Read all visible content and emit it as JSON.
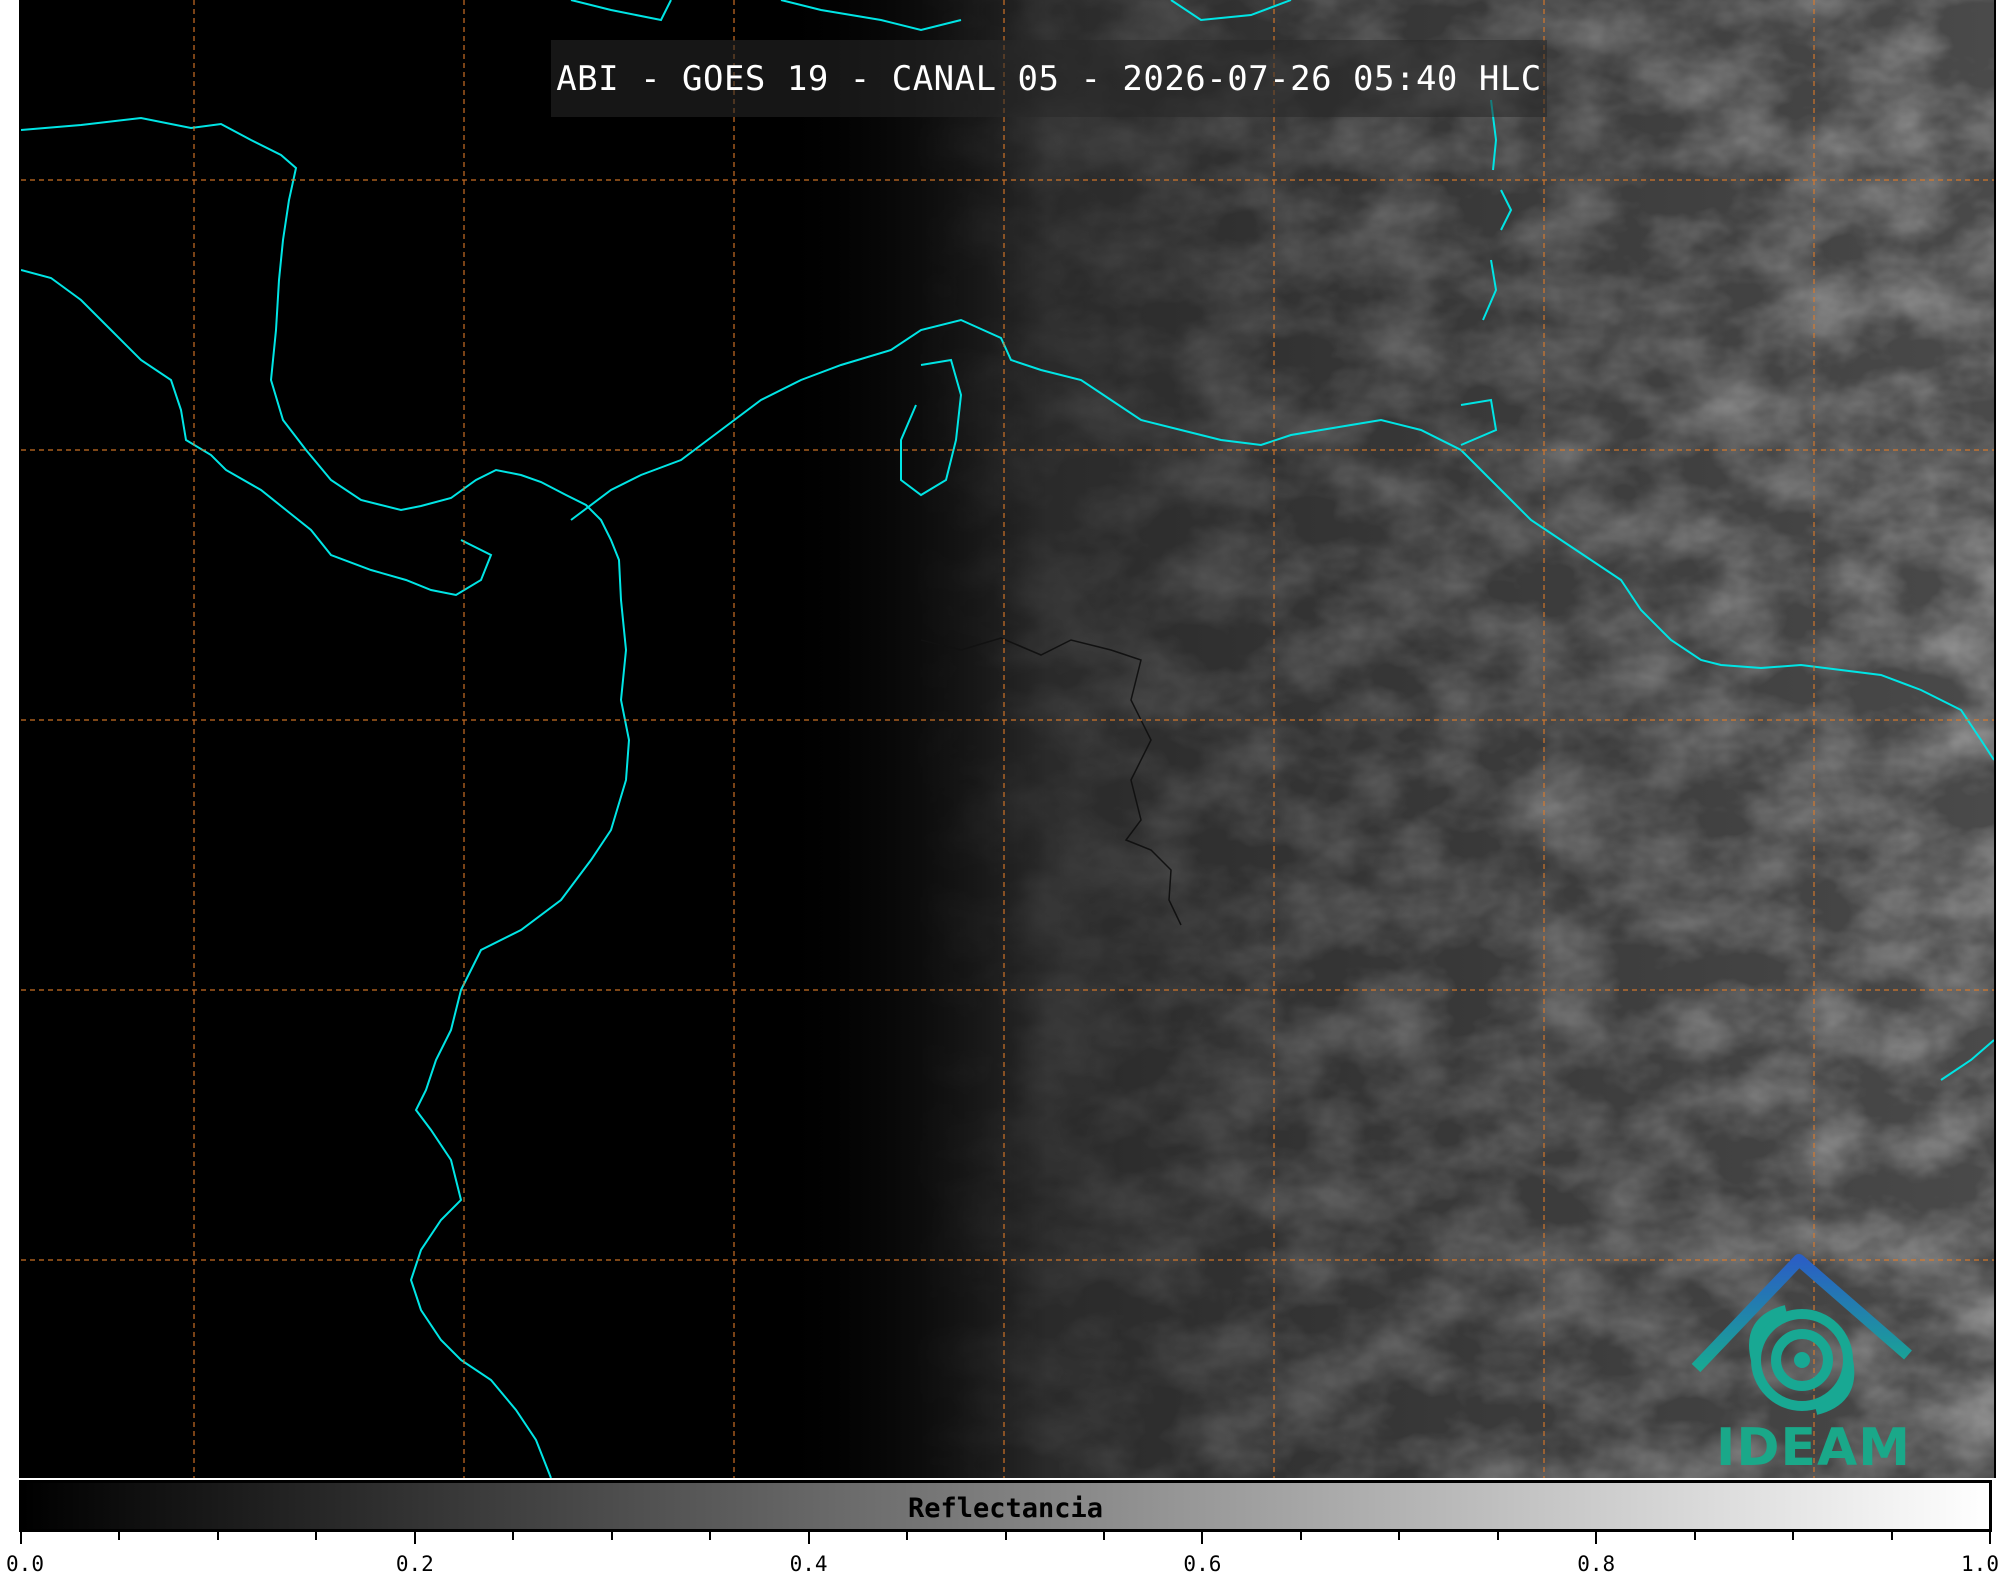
{
  "title": "ABI - GOES 19 - CANAL 05 - 2026-07-26 05:40 HLC",
  "colorbar": {
    "label": "Reflectancia",
    "range": [
      0.0,
      1.0
    ],
    "ticks": [
      "0.0",
      "0.2",
      "0.4",
      "0.6",
      "0.8",
      "1.0"
    ],
    "colormap": "grayscale"
  },
  "logo": {
    "text": "IDEAM"
  },
  "colors": {
    "coastline": "#00e5e5",
    "gridline": "#e07b28",
    "logo_primary": "#1aa889",
    "logo_secondary": "#2a6fc0"
  }
}
